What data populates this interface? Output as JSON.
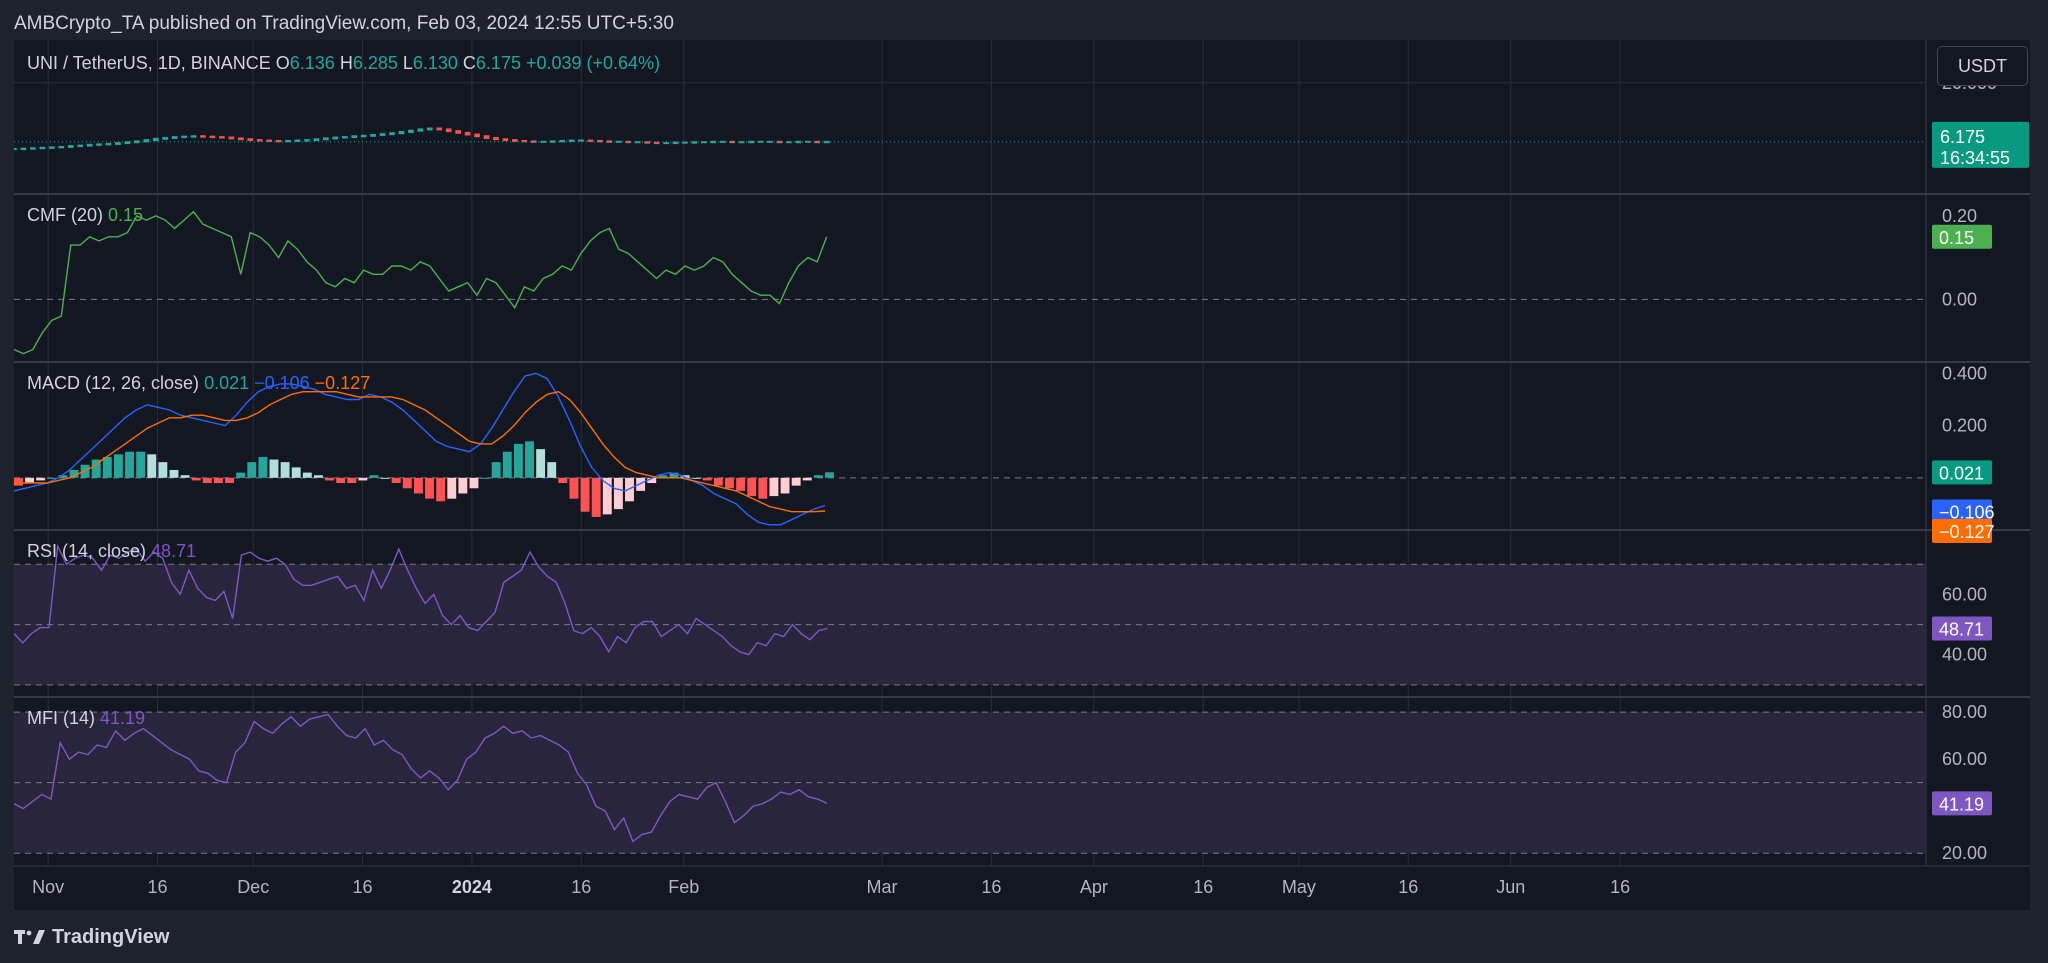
{
  "header": {
    "publisher": "AMBCrypto_TA published on TradingView.com, Feb 03, 2024 12:55 UTC+5:30"
  },
  "footer": {
    "brand": "TradingView"
  },
  "price_scale": {
    "currency": "USDT"
  },
  "colors": {
    "bg": "#131722",
    "panel": "#1e222d",
    "grid": "#2a2e39",
    "text": "#d1d4dc",
    "axis_text": "#b2b5be",
    "up": "#26a69a",
    "down": "#ef5350",
    "cmf": "#4caf50",
    "macd": "#2962ff",
    "signal": "#ff6d00",
    "hist_up_strong": "#26a69a",
    "hist_up_weak": "#b2dfdb",
    "hist_down_strong": "#ff5252",
    "hist_down_weak": "#ffcdd2",
    "rsi": "#7e57c2",
    "mfi": "#7e57c2",
    "band_fill": "#2b2740"
  },
  "chart_data": [
    {
      "type": "candlestick",
      "symbol": "UNI / TetherUS, 1D, BINANCE",
      "ohlc_labels": {
        "o_label": "O",
        "o": "6.136",
        "h_label": "H",
        "h": "6.285",
        "l_label": "L",
        "l": "6.130",
        "c_label": "C",
        "c": "6.175",
        "change": "+0.039 (+0.64%)"
      },
      "last_price": "6.175",
      "countdown": "16:34:55",
      "y_ticks": [
        "20.000"
      ],
      "ylim": [
        -6,
        30
      ],
      "close_values": [
        4.5,
        4.6,
        4.7,
        4.8,
        4.9,
        5.0,
        5.2,
        5.3,
        5.5,
        5.6,
        5.7,
        5.9,
        6.1,
        6.3,
        6.6,
        6.9,
        7.1,
        7.3,
        7.4,
        7.5,
        7.4,
        7.3,
        7.2,
        7.0,
        6.8,
        6.6,
        6.5,
        6.4,
        6.3,
        6.4,
        6.5,
        6.6,
        6.8,
        7.0,
        7.2,
        7.3,
        7.5,
        7.6,
        7.8,
        8.0,
        8.2,
        8.5,
        8.8,
        9.1,
        9.3,
        9.1,
        8.7,
        8.3,
        7.9,
        7.5,
        7.1,
        6.8,
        6.6,
        6.4,
        6.3,
        6.2,
        6.2,
        6.3,
        6.4,
        6.5,
        6.5,
        6.4,
        6.3,
        6.2,
        6.2,
        6.1,
        6.1,
        6.0,
        5.9,
        5.9,
        6.0,
        6.0,
        6.1,
        6.1,
        6.2,
        6.2,
        6.1,
        6.1,
        6.2,
        6.2,
        6.2,
        6.1,
        6.1,
        6.2,
        6.2,
        6.1,
        6.175
      ]
    },
    {
      "type": "line",
      "title": "CMF",
      "params": "(20)",
      "value": "0.15",
      "y_ticks": [
        {
          "value": 0.2,
          "label": "0.20"
        },
        {
          "value": 0.0,
          "label": "0.00"
        }
      ],
      "ylim": [
        -0.15,
        0.25
      ],
      "zero_line": 0.0,
      "values": [
        -0.12,
        -0.13,
        -0.12,
        -0.08,
        -0.05,
        -0.04,
        0.13,
        0.13,
        0.15,
        0.14,
        0.15,
        0.15,
        0.16,
        0.2,
        0.19,
        0.2,
        0.19,
        0.17,
        0.19,
        0.21,
        0.18,
        0.17,
        0.16,
        0.15,
        0.06,
        0.16,
        0.15,
        0.13,
        0.1,
        0.14,
        0.12,
        0.09,
        0.07,
        0.04,
        0.03,
        0.05,
        0.04,
        0.07,
        0.06,
        0.06,
        0.08,
        0.08,
        0.07,
        0.09,
        0.08,
        0.05,
        0.02,
        0.03,
        0.04,
        0.01,
        0.05,
        0.04,
        0.01,
        -0.02,
        0.03,
        0.02,
        0.05,
        0.06,
        0.08,
        0.07,
        0.11,
        0.14,
        0.16,
        0.17,
        0.12,
        0.11,
        0.09,
        0.07,
        0.05,
        0.07,
        0.06,
        0.08,
        0.07,
        0.08,
        0.1,
        0.09,
        0.06,
        0.04,
        0.02,
        0.01,
        0.01,
        -0.01,
        0.04,
        0.08,
        0.1,
        0.09,
        0.15
      ]
    },
    {
      "type": "line",
      "title": "MACD",
      "params": "(12, 26, close)",
      "values_text": {
        "histogram": "0.021",
        "macd": "−0.106",
        "signal": "−0.127"
      },
      "y_ticks": [
        {
          "value": 0.4,
          "label": "0.400"
        },
        {
          "value": 0.2,
          "label": "0.200"
        }
      ],
      "ylim": [
        -0.2,
        0.44
      ],
      "zero_line": 0.0,
      "series": [
        {
          "name": "MACD",
          "values": [
            -0.05,
            -0.04,
            -0.03,
            -0.02,
            0.0,
            0.03,
            0.07,
            0.11,
            0.15,
            0.19,
            0.23,
            0.26,
            0.28,
            0.27,
            0.26,
            0.24,
            0.23,
            0.22,
            0.21,
            0.2,
            0.24,
            0.29,
            0.33,
            0.35,
            0.36,
            0.36,
            0.35,
            0.34,
            0.32,
            0.31,
            0.3,
            0.3,
            0.32,
            0.31,
            0.29,
            0.26,
            0.22,
            0.18,
            0.14,
            0.12,
            0.11,
            0.1,
            0.13,
            0.19,
            0.26,
            0.33,
            0.39,
            0.4,
            0.38,
            0.31,
            0.22,
            0.12,
            0.04,
            -0.01,
            -0.04,
            -0.05,
            -0.03,
            -0.01,
            0.01,
            0.02,
            0.01,
            -0.01,
            -0.03,
            -0.06,
            -0.08,
            -0.1,
            -0.14,
            -0.17,
            -0.18,
            -0.18,
            -0.16,
            -0.14,
            -0.12,
            -0.106
          ]
        },
        {
          "name": "Signal",
          "values": [
            -0.02,
            -0.02,
            -0.02,
            -0.02,
            -0.01,
            0.0,
            0.02,
            0.04,
            0.07,
            0.1,
            0.13,
            0.16,
            0.19,
            0.21,
            0.23,
            0.23,
            0.24,
            0.24,
            0.23,
            0.22,
            0.22,
            0.23,
            0.25,
            0.28,
            0.3,
            0.32,
            0.33,
            0.33,
            0.33,
            0.33,
            0.32,
            0.31,
            0.31,
            0.31,
            0.31,
            0.3,
            0.28,
            0.26,
            0.23,
            0.2,
            0.17,
            0.14,
            0.13,
            0.13,
            0.16,
            0.2,
            0.25,
            0.29,
            0.32,
            0.33,
            0.3,
            0.25,
            0.19,
            0.13,
            0.08,
            0.04,
            0.02,
            0.01,
            0.0,
            0.0,
            0.0,
            -0.01,
            -0.02,
            -0.03,
            -0.04,
            -0.05,
            -0.07,
            -0.09,
            -0.11,
            -0.12,
            -0.13,
            -0.13,
            -0.13,
            -0.127
          ]
        }
      ],
      "histogram": [
        -0.03,
        -0.02,
        -0.01,
        0.0,
        0.01,
        0.03,
        0.05,
        0.07,
        0.08,
        0.09,
        0.1,
        0.1,
        0.09,
        0.06,
        0.03,
        0.01,
        -0.01,
        -0.02,
        -0.02,
        -0.02,
        0.02,
        0.06,
        0.08,
        0.07,
        0.06,
        0.04,
        0.02,
        0.01,
        -0.01,
        -0.02,
        -0.02,
        -0.01,
        0.01,
        0.0,
        -0.02,
        -0.04,
        -0.06,
        -0.08,
        -0.09,
        -0.08,
        -0.06,
        -0.04,
        0.0,
        0.06,
        0.1,
        0.13,
        0.14,
        0.11,
        0.06,
        -0.02,
        -0.08,
        -0.13,
        -0.15,
        -0.14,
        -0.12,
        -0.09,
        -0.05,
        -0.02,
        0.01,
        0.02,
        0.01,
        0.0,
        -0.01,
        -0.03,
        -0.04,
        -0.05,
        -0.07,
        -0.08,
        -0.07,
        -0.06,
        -0.03,
        -0.01,
        0.01,
        0.021
      ]
    },
    {
      "type": "line",
      "title": "RSI",
      "params": "(14, close)",
      "value": "48.71",
      "y_ticks": [
        {
          "value": 60,
          "label": "60.00"
        },
        {
          "value": 40,
          "label": "40.00"
        }
      ],
      "ylim": [
        26,
        81
      ],
      "bands": [
        70,
        50,
        30
      ],
      "values": [
        47,
        44,
        47,
        49,
        49,
        76,
        70,
        72,
        73,
        72,
        68,
        73,
        72,
        74,
        75,
        71,
        74,
        72,
        64,
        60,
        68,
        62,
        59,
        58,
        61,
        52,
        73,
        74,
        72,
        71,
        72,
        70,
        65,
        63,
        63,
        64,
        65,
        66,
        62,
        63,
        58,
        68,
        62,
        68,
        75,
        68,
        62,
        57,
        60,
        53,
        50,
        53,
        49,
        48,
        51,
        54,
        64,
        66,
        68,
        74,
        69,
        66,
        64,
        57,
        48,
        47,
        49,
        46,
        41,
        46,
        44,
        49,
        51,
        51,
        46,
        48,
        50,
        47,
        52,
        50,
        48,
        46,
        43,
        41,
        40,
        44,
        43,
        47,
        46,
        50,
        47,
        45,
        48,
        48.71
      ]
    },
    {
      "type": "line",
      "title": "MFI",
      "params": "(14)",
      "value": "41.19",
      "y_ticks": [
        {
          "value": 80,
          "label": "80.00"
        },
        {
          "value": 60,
          "label": "60.00"
        },
        {
          "value": 20,
          "label": "20.00"
        }
      ],
      "ylim": [
        15,
        86
      ],
      "bands": [
        80,
        50,
        20
      ],
      "values": [
        41,
        39,
        42,
        45,
        43,
        67,
        60,
        63,
        62,
        66,
        65,
        72,
        68,
        71,
        73,
        70,
        67,
        64,
        62,
        60,
        55,
        54,
        51,
        50,
        63,
        67,
        76,
        73,
        71,
        75,
        78,
        74,
        77,
        78,
        79,
        74,
        70,
        69,
        73,
        66,
        68,
        64,
        62,
        56,
        52,
        55,
        52,
        47,
        51,
        60,
        63,
        69,
        71,
        74,
        71,
        72,
        69,
        70,
        68,
        66,
        63,
        54,
        49,
        40,
        38,
        30,
        35,
        25,
        28,
        29,
        36,
        42,
        45,
        44,
        43,
        48,
        50,
        42,
        33,
        36,
        40,
        41,
        43,
        46,
        45,
        47,
        44,
        43,
        41.19
      ]
    }
  ],
  "x_axis": {
    "ticks": [
      "Nov",
      "16",
      "Dec",
      "16",
      "2024",
      "16",
      "Feb",
      "Mar",
      "16",
      "Apr",
      "16",
      "May",
      "16",
      "Jun",
      "16"
    ],
    "bold_index": 4
  }
}
